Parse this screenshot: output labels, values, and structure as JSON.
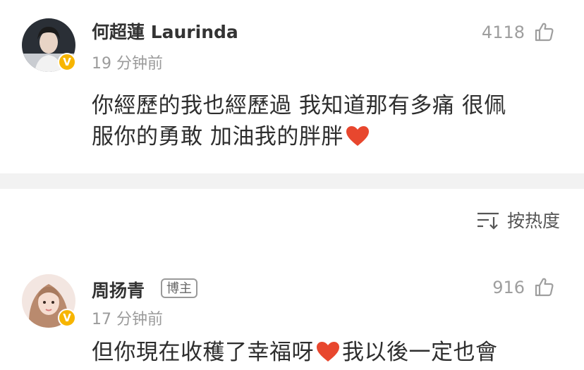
{
  "comments": [
    {
      "username": "何超蓮 Laurinda",
      "verified": true,
      "verified_badge_text": "V",
      "timestamp": "19 分钟前",
      "likes": "4118",
      "text_line1": "你經歷的我也經歷過 我知道那有多痛 很佩",
      "text_line2": "服你的勇敢 加油我的胖胖"
    },
    {
      "username": "周扬青",
      "role_badge": "博主",
      "verified": true,
      "verified_badge_text": "V",
      "timestamp": "17 分钟前",
      "likes": "916",
      "text_part1": "但你現在收穫了幸福呀",
      "text_part2": "我以後一定也會"
    }
  ],
  "sort": {
    "label": "按热度",
    "icon": "sort-icon"
  },
  "icons": {
    "like": "thumbs-up-icon",
    "heart": "red-heart-emoji",
    "verified": "verified-badge-icon"
  },
  "colors": {
    "verified_badge": "#f7b500",
    "heart": "#e8472e",
    "secondary_text": "#9b9b9b",
    "divider": "#f2f2f2"
  }
}
